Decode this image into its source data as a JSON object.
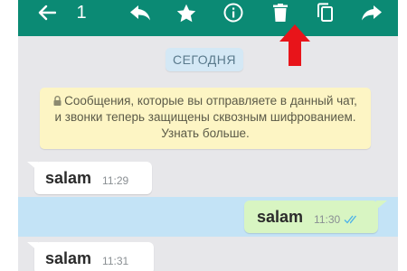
{
  "toolbar": {
    "background": "#0b8a74",
    "selected_count": "1",
    "icons": [
      "back-arrow-icon",
      "reply-icon",
      "star-icon",
      "info-icon",
      "delete-icon",
      "copy-icon",
      "forward-icon"
    ]
  },
  "annotation": {
    "type": "red-arrow-pointing-up",
    "color": "#e8141a",
    "target": "delete-icon"
  },
  "chat": {
    "date_label": "СЕГОДНЯ",
    "encryption_notice": "Сообщения, которые вы отправляете в данный чат, и звонки теперь защищены сквозным шифрованием. Узнать больше.",
    "messages": [
      {
        "direction": "incoming",
        "text": "salam",
        "time": "11:29",
        "selected": false
      },
      {
        "direction": "outgoing",
        "text": "salam",
        "time": "11:30",
        "status": "read",
        "selected": true
      },
      {
        "direction": "incoming",
        "text": "salam",
        "time": "11:31",
        "selected": false
      }
    ]
  }
}
